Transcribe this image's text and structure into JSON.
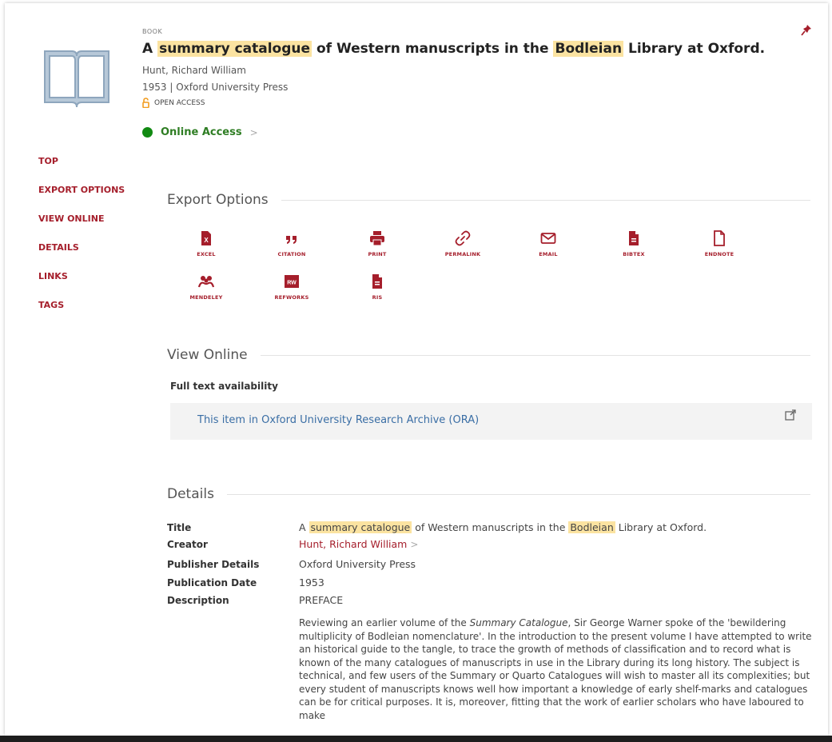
{
  "record": {
    "type_label": "BOOK",
    "title_parts": [
      "A ",
      "summary catalogue",
      " of Western manuscripts in the ",
      "Bodleian",
      " Library at Oxford."
    ],
    "creator": "Hunt, Richard William",
    "publication": "1953 | Oxford University Press",
    "open_access": "OPEN ACCESS",
    "online_access": "Online Access",
    "online_chevron": ">"
  },
  "nav": [
    "TOP",
    "EXPORT OPTIONS",
    "VIEW ONLINE",
    "DETAILS",
    "LINKS",
    "TAGS"
  ],
  "export": {
    "heading": "Export Options",
    "items": [
      {
        "label": "EXCEL",
        "icon": "excel-icon"
      },
      {
        "label": "CITATION",
        "icon": "quote-icon"
      },
      {
        "label": "PRINT",
        "icon": "print-icon"
      },
      {
        "label": "PERMALINK",
        "icon": "link-icon"
      },
      {
        "label": "EMAIL",
        "icon": "envelope-icon"
      },
      {
        "label": "BIBTEX",
        "icon": "file-icon"
      },
      {
        "label": "ENDNOTE",
        "icon": "file-outline-icon"
      },
      {
        "label": "MENDELEY",
        "icon": "mendeley-icon"
      },
      {
        "label": "REFWORKS",
        "icon": "refworks-icon",
        "badge": "RW"
      },
      {
        "label": "RIS",
        "icon": "file-icon"
      }
    ]
  },
  "view_online": {
    "heading": "View Online",
    "fulltext_label": "Full text availability",
    "link_text": "This item in Oxford University Research Archive (ORA)"
  },
  "details": {
    "heading": "Details",
    "title_label": "Title",
    "title_parts": [
      "A ",
      "summary catalogue",
      " of Western manuscripts in the ",
      "Bodleian",
      " Library at Oxford."
    ],
    "creator_label": "Creator",
    "creator_value": "Hunt, Richard William",
    "creator_chevron": ">",
    "publisher_label": "Publisher Details",
    "publisher_value": "Oxford University Press",
    "date_label": "Publication Date",
    "date_value": "1953",
    "description_label": "Description",
    "description_first": "PREFACE",
    "description_pre": "Reviewing an earlier volume of the ",
    "description_italic": "Summary Catalogue",
    "description_post": ", Sir George Warner spoke of the 'bewildering multiplicity of Bodleian nomenclature'. In the introduction to the present volume I have attempted to write an historical guide to the tangle, to trace the growth of methods of classification and to record what is known of the many catalogues of manuscripts in use in the Library during its long history. The subject is technical, and few users of the Summary or Quarto Catalogues will wish to master all its complexities; but every student of manuscripts knows well how important a knowledge of early shelf-marks and catalogues can be for critical purposes. It is, moreover, fitting that the work of earlier scholars who have laboured to make"
  },
  "colors": {
    "accent": "#a51e2b",
    "highlight": "#fbe3a1",
    "online": "#118a12",
    "link": "#3a6ea5"
  }
}
